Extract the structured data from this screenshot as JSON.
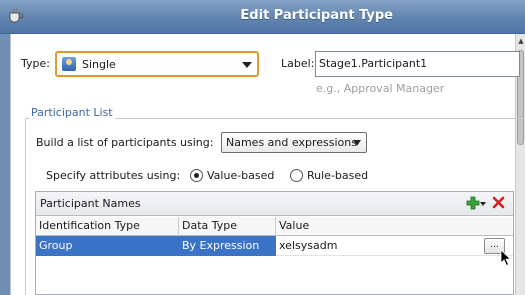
{
  "window": {
    "title": "Edit Participant Type"
  },
  "type_field": {
    "label": "Type:",
    "value": "Single",
    "icon": "single-participant-icon"
  },
  "label_field": {
    "label": "Label:",
    "value": "Stage1.Participant1",
    "hint": "e.g., Approval Manager"
  },
  "participant_list": {
    "title": "Participant List",
    "build_label": "Build a list of participants using:",
    "build_value": "Names and expressions",
    "specify_label": "Specify attributes using:",
    "radio_value_based": "Value-based",
    "radio_rule_based": "Rule-based",
    "selected_radio": "Value-based"
  },
  "names_table": {
    "title": "Participant Names",
    "columns": [
      "Identification Type",
      "Data Type",
      "Value"
    ],
    "rows": [
      {
        "identification_type": "Group",
        "data_type": "By Expression",
        "value": "xelsysadm",
        "ellipsis": "..."
      }
    ]
  },
  "colors": {
    "titlebar": "#5a80ae",
    "selection": "#3b73c6",
    "group_title": "#3c66a6",
    "focus_border": "#e09a2a"
  }
}
